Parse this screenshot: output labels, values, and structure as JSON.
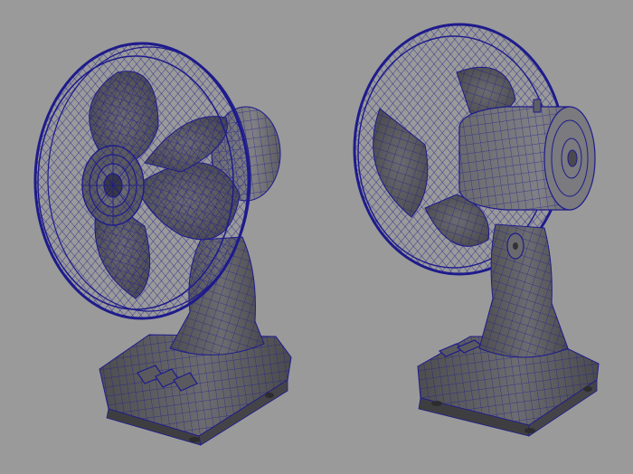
{
  "scene": {
    "background": "#9a9a9a",
    "wire_color": "#1e1b8c",
    "surface_dark": "#4a4a4c",
    "surface_mid": "#5f5f62",
    "surface_light": "#76767a",
    "objects": [
      "desk-fan-front-view",
      "desk-fan-rear-view"
    ]
  }
}
